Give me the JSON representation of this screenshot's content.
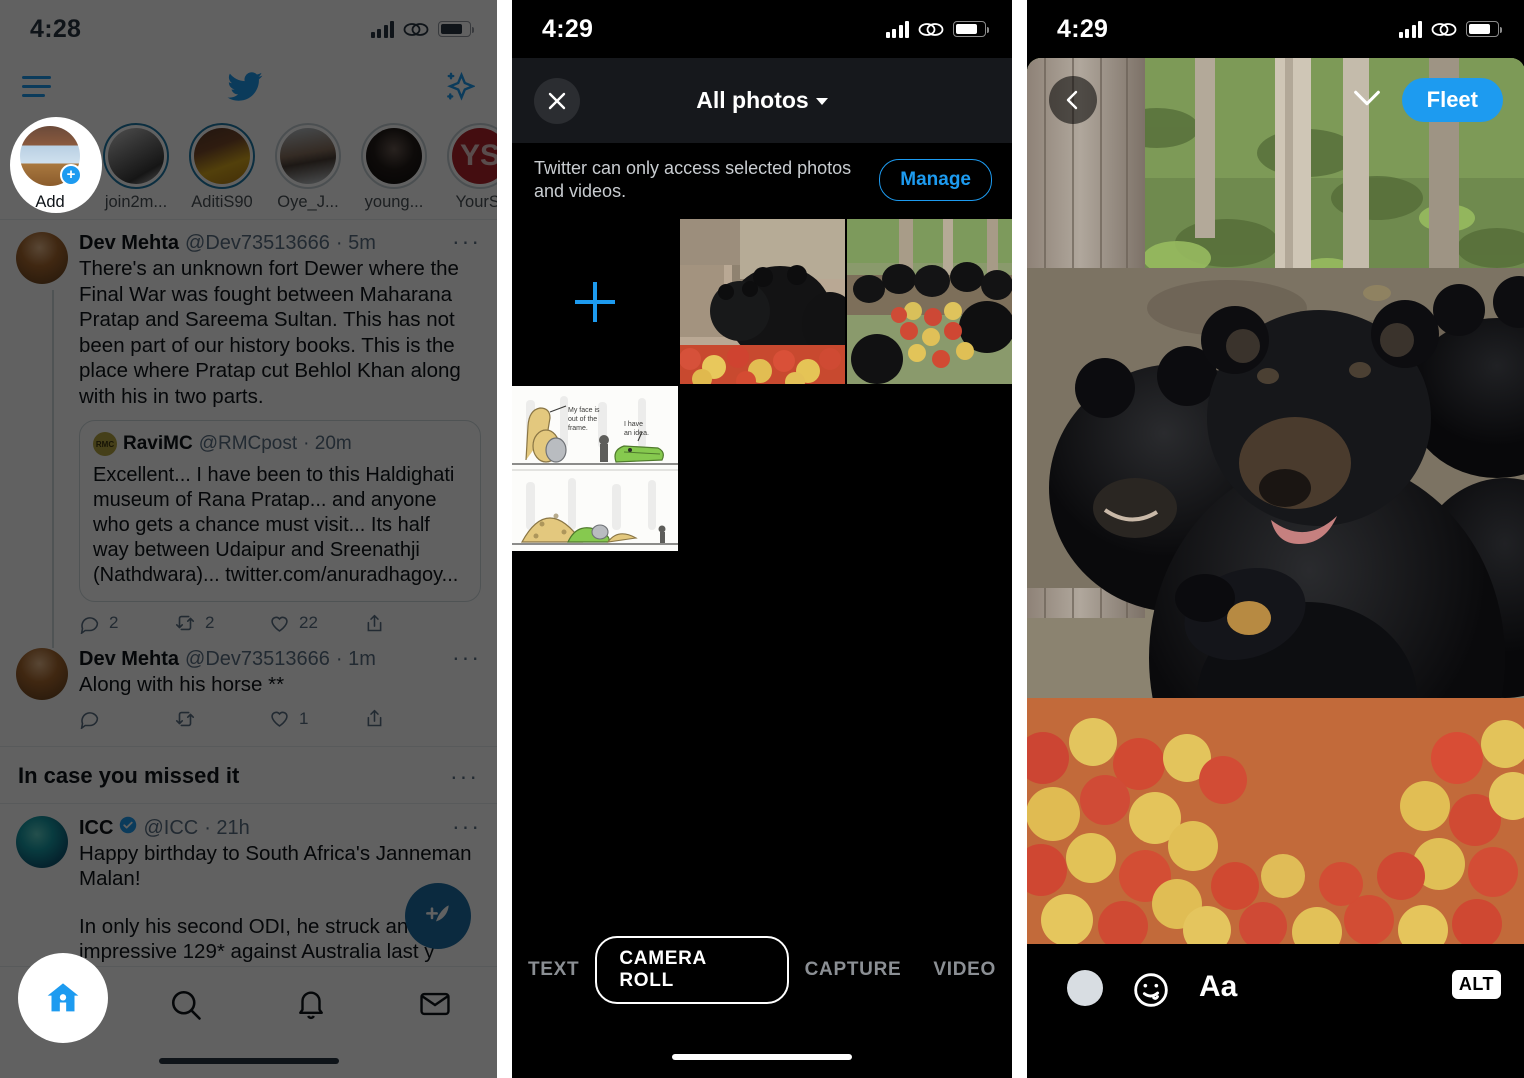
{
  "panels": {
    "timeline": {
      "status": {
        "time": "4:28"
      },
      "header": {
        "menu_icon": "hamburger-menu-icon",
        "logo": "twitter-bird-icon",
        "sparkle": "sparkle-icon"
      },
      "stories": [
        {
          "name": "Add",
          "state": "add"
        },
        {
          "name": "join2m...",
          "state": "unseen"
        },
        {
          "name": "AditiS90",
          "state": "unseen"
        },
        {
          "name": "Oye_J...",
          "state": "seen"
        },
        {
          "name": "young...",
          "state": "seen"
        },
        {
          "name": "YourSt",
          "state": "seen"
        }
      ],
      "tweets": [
        {
          "name": "Dev Mehta",
          "handle": "@Dev73513666",
          "time": "5m",
          "dots": "···",
          "text": "There's an unknown fort Dewer where the Final War was fought  between Maharana Pratap and Sareema Sultan. This has not been part of our history books. This is the place where Pratap cut Behlol Khan along with his in two parts.",
          "quote": {
            "name": "RaviMC",
            "handle": "@RMCpost",
            "time": "20m",
            "avatar_text": "RMC",
            "text": "Excellent... I have been to this Haldighati museum of Rana Pratap... and anyone who gets a chance must visit... Its half way between Udaipur and Sreenathji (Nathdwara)... twitter.com/anuradhagoy..."
          },
          "actions": {
            "reply": "2",
            "retweet": "2",
            "like": "22",
            "share": ""
          }
        },
        {
          "name": "Dev Mehta",
          "handle": "@Dev73513666",
          "time": "1m",
          "dots": "···",
          "text": "Along with his horse **",
          "actions": {
            "reply": "",
            "retweet": "",
            "like": "1",
            "share": ""
          }
        }
      ],
      "section": {
        "title": "In case you missed it",
        "dots": "···"
      },
      "icc_tweet": {
        "name": "ICC",
        "handle": "@ICC",
        "time": "21h",
        "dots": "···",
        "verified": true,
        "text_1": "Happy birthday to South Africa's Janneman Malan!",
        "text_2": "In only his second ODI, he struck an impressive 129* against Australia last y"
      },
      "tabbar": [
        {
          "icon": "home-icon",
          "active": true
        },
        {
          "icon": "search-icon",
          "active": false
        },
        {
          "icon": "bell-icon",
          "active": false
        },
        {
          "icon": "mail-icon",
          "active": false
        }
      ],
      "fab": {
        "icon": "compose-tweet-icon"
      },
      "accent_color": "#1d9bf0"
    },
    "photo_picker": {
      "status": {
        "time": "4:29"
      },
      "close_icon": "close-icon",
      "title": "All photos",
      "title_caret": "chevron-down-icon",
      "permission": {
        "text": "Twitter can only access selected photos and videos.",
        "button": "Manage"
      },
      "grid": [
        {
          "type": "add",
          "label": "add-photo-tile"
        },
        {
          "type": "photo",
          "label": "bears-eating-apples-closeup"
        },
        {
          "type": "photo",
          "label": "bears-group-apples"
        },
        {
          "type": "photo",
          "label": "giraffe-crocodile-comic"
        }
      ],
      "comic_text": {
        "line1": "My face is out of the frame.",
        "line2": "I have an idea."
      },
      "tabs": [
        {
          "label": "TEXT",
          "active": false
        },
        {
          "label": "CAMERA ROLL",
          "active": true
        },
        {
          "label": "CAPTURE",
          "active": false
        },
        {
          "label": "VIDEO",
          "active": false
        }
      ],
      "accent_color": "#1d9bf0"
    },
    "fleet_composer": {
      "status": {
        "time": "4:29"
      },
      "back_icon": "chevron-left-icon",
      "collapse_icon": "chevron-down-icon",
      "fleet_button": "Fleet",
      "photo_label": "black-bears-eating-apples",
      "toolbar": [
        {
          "name": "draw-color-swatch",
          "label": ""
        },
        {
          "name": "sticker-icon",
          "label": ""
        },
        {
          "name": "text-tool",
          "label": "Aa"
        },
        {
          "name": "alt-text-badge",
          "label": "ALT"
        }
      ],
      "accent_color": "#1d9bf0"
    }
  }
}
